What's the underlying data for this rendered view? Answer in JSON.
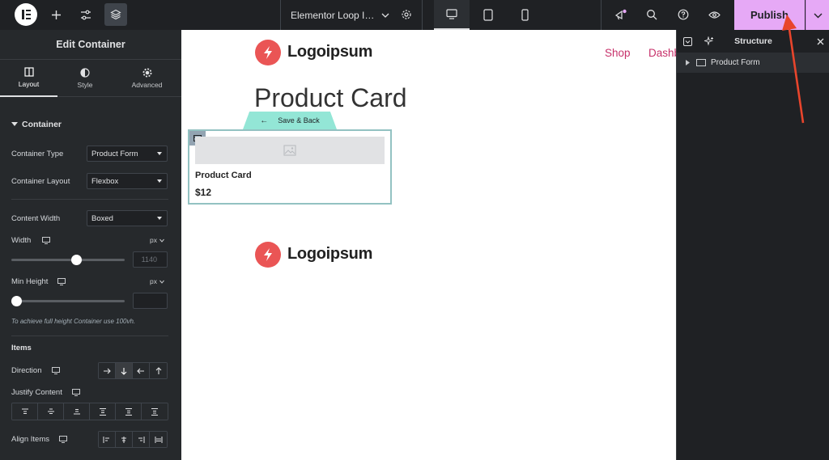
{
  "topbar": {
    "document_title": "Elementor Loop Item",
    "publish_label": "Publish"
  },
  "left_panel": {
    "title": "Edit Container",
    "tabs": [
      {
        "label": "Layout",
        "icon": "layout-icon",
        "active": true
      },
      {
        "label": "Style",
        "icon": "half-circle-icon",
        "active": false
      },
      {
        "label": "Advanced",
        "icon": "gear-icon",
        "active": false
      }
    ],
    "section_container": "Container",
    "container_type": {
      "label": "Container Type",
      "value": "Product Form"
    },
    "container_layout": {
      "label": "Container Layout",
      "value": "Flexbox"
    },
    "content_width": {
      "label": "Content Width",
      "value": "Boxed"
    },
    "width": {
      "label": "Width",
      "unit": "px",
      "placeholder": "1140",
      "value_fraction": 0.58
    },
    "min_height": {
      "label": "Min Height",
      "unit": "px",
      "placeholder": "",
      "value_fraction": 0.0
    },
    "hint": "To achieve full height Container use 100vh.",
    "section_items": "Items",
    "direction": {
      "label": "Direction",
      "selected": "column"
    },
    "justify_content": {
      "label": "Justify Content"
    },
    "align_items": {
      "label": "Align Items"
    }
  },
  "canvas": {
    "logo_text": "Logoipsum",
    "nav": [
      "Shop",
      "Dashb"
    ],
    "page_title": "Product Card",
    "save_back": "Save & Back",
    "card": {
      "name": "Product Card",
      "price": "$12"
    },
    "footer_logo_text": "Logoipsum"
  },
  "structure_panel": {
    "title": "Structure",
    "items": [
      {
        "label": "Product Form"
      }
    ]
  },
  "colors": {
    "topbar_bg": "#1f2124",
    "panel_bg": "#26292c",
    "publish_bg": "#e6a9f6",
    "accent_teal": "#93e6d6",
    "logo_red": "#ea5555",
    "nav_link": "#c7316a",
    "annotation_arrow": "#e8452c"
  }
}
